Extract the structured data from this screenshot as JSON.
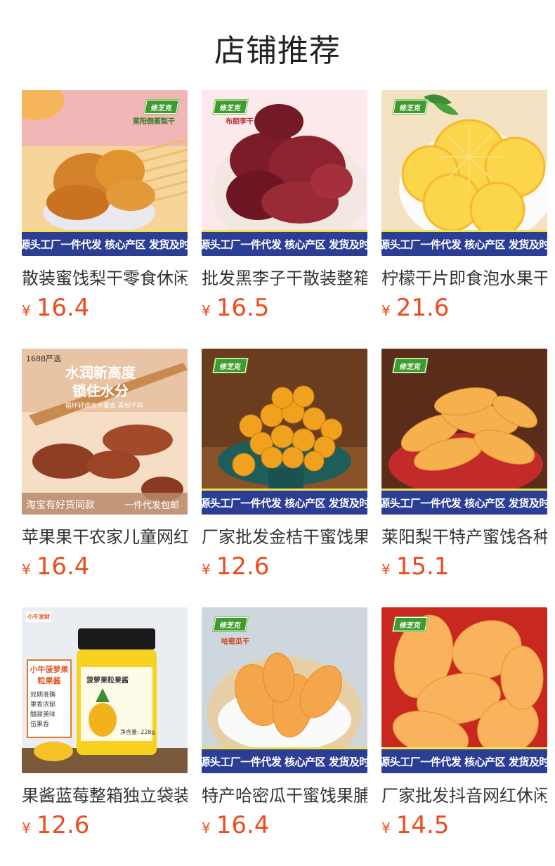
{
  "page": {
    "title": "店铺推荐"
  },
  "products": [
    {
      "name": "散装蜜饯梨干零食休闲",
      "currency": "¥",
      "price": "16.4",
      "banner": "源头工厂一件代发 核心产区 发货及时",
      "brand": "修芝克",
      "label": "莱阳倒蒸梨干"
    },
    {
      "name": "批发黑李子干散装整箱",
      "currency": "¥",
      "price": "16.5",
      "banner": "源头工厂一件代发 核心产区 发货及时",
      "brand": "修芝克",
      "label": "布朗李干"
    },
    {
      "name": "柠檬干片即食泡水果干",
      "currency": "¥",
      "price": "21.6",
      "banner": "源头工厂一件代发 核心产区 发货及时",
      "brand": "修芝克"
    },
    {
      "name": "苹果果干农家儿童网红",
      "currency": "¥",
      "price": "16.4",
      "tag": "1688严选",
      "headline1": "水润新高度",
      "headline2": "锁住水分",
      "sub": "循环轻烘含水量高 柔韧不碎",
      "footer_left": "淘宝有好货同款",
      "footer_right": "一件代发包邮"
    },
    {
      "name": "厂家批发金桔干蜜饯果脯",
      "currency": "¥",
      "price": "12.6",
      "banner": "源头工厂一件代发 核心产区 发货及时",
      "brand": "修芝克"
    },
    {
      "name": "莱阳梨干特产蜜饯各种",
      "currency": "¥",
      "price": "15.1",
      "banner": "源头工厂一件代发 核心产区 发货及时",
      "brand": "修芝克"
    },
    {
      "name": "果酱蓝莓整箱独立袋装",
      "currency": "¥",
      "price": "12.6",
      "badge": "小牛发财",
      "jam_title": "小牛菠萝果粒果酱",
      "jam_points": [
        "效期准确",
        "果香浓郁",
        "酸甜美味",
        "伍果香"
      ],
      "jar_label": "菠萝果粒果酱",
      "jar_net": "净含量: 228g"
    },
    {
      "name": "特产哈密瓜干蜜饯果脯",
      "currency": "¥",
      "price": "16.4",
      "banner": "源头工厂一件代发 核心产区 发货及时",
      "brand": "修芝克",
      "label": "哈密瓜干"
    },
    {
      "name": "厂家批发抖音网红休闲",
      "currency": "¥",
      "price": "14.5",
      "banner": "源头工厂一件代发 核心产区 发货及时",
      "brand": "修芝克"
    }
  ]
}
